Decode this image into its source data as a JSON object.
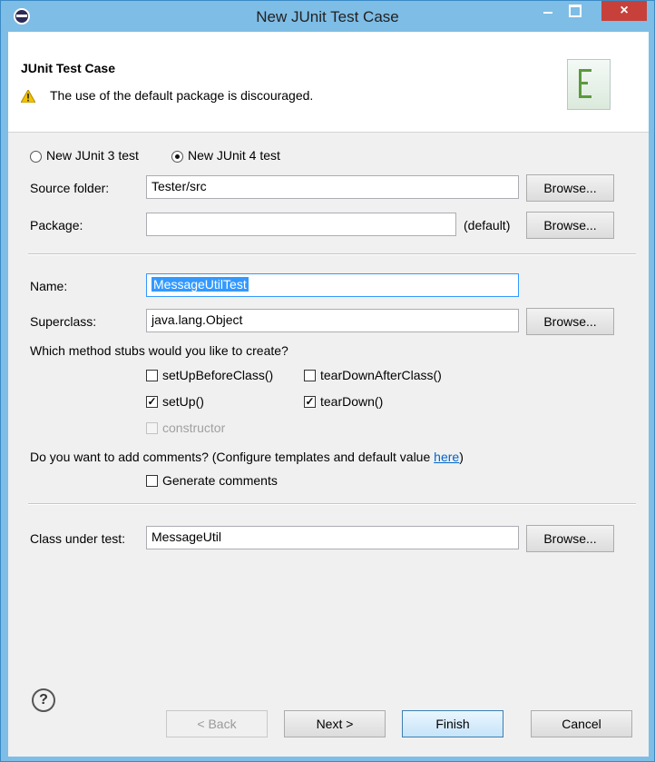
{
  "window": {
    "title": "New JUnit Test Case",
    "close_glyph": "×"
  },
  "banner": {
    "title": "JUnit Test Case",
    "warning": "The use of the default package is discouraged."
  },
  "version": {
    "junit3_label": "New JUnit 3 test",
    "junit4_label": "New JUnit 4 test",
    "selected": "New JUnit 4 test"
  },
  "form": {
    "source_folder_label": "Source folder:",
    "source_folder_value": "Tester/src",
    "package_label": "Package:",
    "package_value": "",
    "package_default": "(default)",
    "name_label": "Name:",
    "name_value": "MessageUtilTest",
    "superclass_label": "Superclass:",
    "superclass_value": "java.lang.Object",
    "browse_label": "Browse..."
  },
  "stubs": {
    "question": "Which method stubs would you like to create?",
    "setUpBeforeClass": {
      "label": "setUpBeforeClass()",
      "checked": false
    },
    "tearDownAfterClass": {
      "label": "tearDownAfterClass()",
      "checked": false
    },
    "setUp": {
      "label": "setUp()",
      "checked": true
    },
    "tearDown": {
      "label": "tearDown()",
      "checked": true
    },
    "constructor": {
      "label": "constructor",
      "checked": false,
      "enabled": false
    }
  },
  "comments": {
    "question_prefix": "Do you want to add comments? (Configure templates and default value ",
    "link": "here",
    "question_suffix": ")",
    "generate_label": "Generate comments"
  },
  "class_under_test": {
    "label": "Class under test:",
    "value": "MessageUtil"
  },
  "footer": {
    "help": "?",
    "back": "< Back",
    "next": "Next >",
    "finish": "Finish",
    "cancel": "Cancel"
  },
  "check_glyph": "✓",
  "colors": {
    "title_bar": "#7ebde6",
    "close_button": "#c7413a",
    "selection": "#3399ff",
    "link": "#0066cc"
  }
}
